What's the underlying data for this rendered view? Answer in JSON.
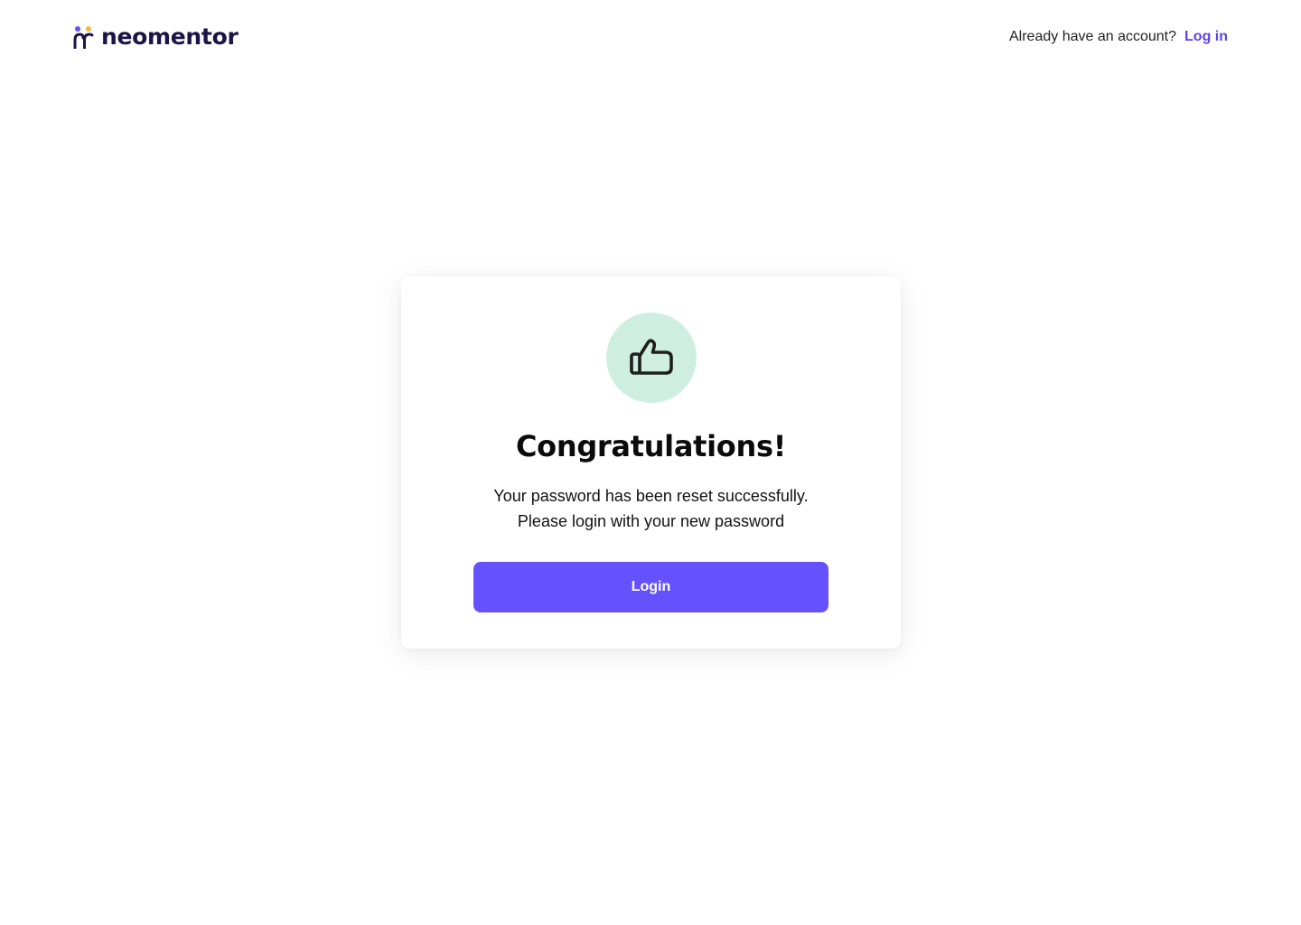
{
  "header": {
    "brand_name": "neomentor",
    "account_question": "Already have an account?",
    "login_link": "Log in"
  },
  "card": {
    "icon": "thumbs-up-icon",
    "title": "Congratulations!",
    "message_line1": "Your password has been reset successfully.",
    "message_line2": "Please login with your new password",
    "button_label": "Login"
  },
  "colors": {
    "brand_text": "#1b1446",
    "accent": "#6652fd",
    "link": "#5a44e6",
    "icon_bg": "#cfeee2",
    "logo_dot_left": "#6652fd",
    "logo_dot_right": "#f5b942"
  }
}
